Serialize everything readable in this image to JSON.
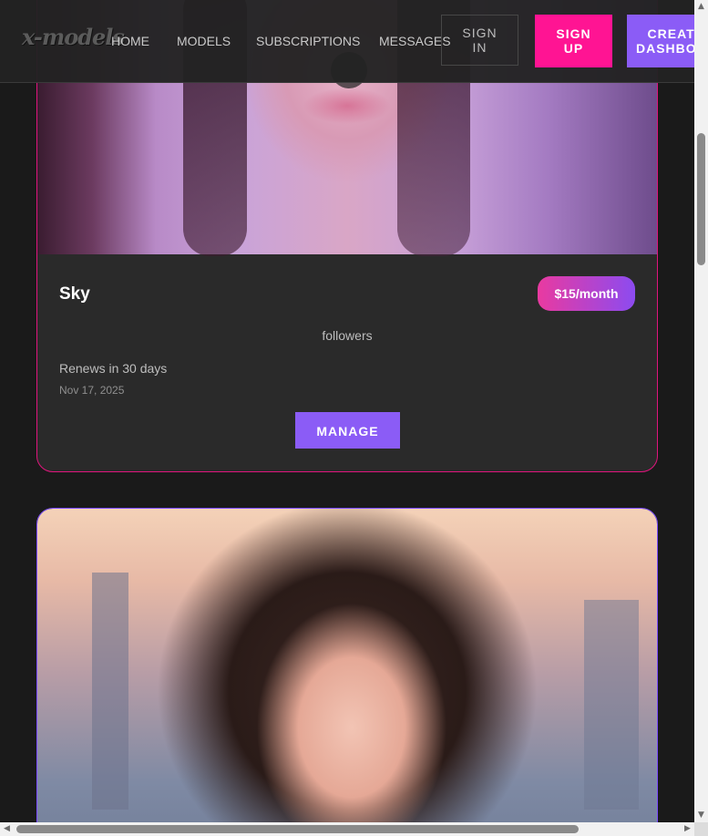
{
  "header": {
    "logo_text": "x-models",
    "nav": {
      "home": "HOME",
      "models": "MODELS",
      "subscriptions": "SUBSCRIPTIONS",
      "messages": "MESSAGES"
    },
    "sign_in": "SIGN IN",
    "sign_up": "SIGN UP",
    "create_dashboard": "CREATOR DASHBOARD"
  },
  "subscription_card": {
    "name": "Sky",
    "price": "$15/month",
    "followers_label": "followers",
    "renews_text": "Renews in 30 days",
    "date": "Nov 17, 2025",
    "manage_label": "MANAGE"
  },
  "colors": {
    "accent_pink": "#ff1493",
    "accent_purple": "#8b5cf6",
    "background": "#1a1a1a",
    "card": "#2a2a2a"
  },
  "icons": {
    "scroll_up": "▲",
    "scroll_down": "▼",
    "scroll_left": "◀",
    "scroll_right": "▶"
  }
}
